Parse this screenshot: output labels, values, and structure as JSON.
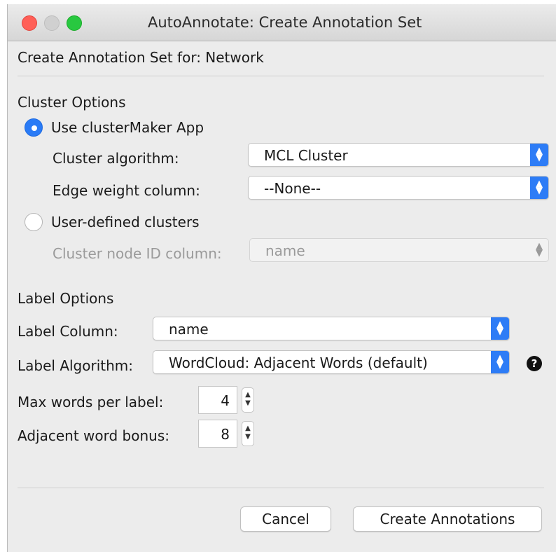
{
  "window": {
    "title": "AutoAnnotate: Create Annotation Set"
  },
  "header": {
    "text": "Create Annotation Set for: Network"
  },
  "cluster_options": {
    "heading": "Cluster Options",
    "use_clustermaker_label": "Use clusterMaker App",
    "use_clustermaker_selected": true,
    "cluster_algorithm_label": "Cluster algorithm:",
    "cluster_algorithm_value": "MCL Cluster",
    "edge_weight_label": "Edge weight column:",
    "edge_weight_value": "--None--",
    "user_defined_label": "User-defined clusters",
    "user_defined_selected": false,
    "node_id_label": "Cluster node ID column:",
    "node_id_value": "name"
  },
  "label_options": {
    "heading": "Label Options",
    "label_column_label": "Label Column:",
    "label_column_value": "name",
    "label_algorithm_label": "Label Algorithm:",
    "label_algorithm_value": "WordCloud: Adjacent Words (default)",
    "max_words_label": "Max words per label:",
    "max_words_value": "4",
    "adjacent_bonus_label": "Adjacent word bonus:",
    "adjacent_bonus_value": "8"
  },
  "buttons": {
    "cancel": "Cancel",
    "create": "Create Annotations"
  },
  "icons": {
    "help": "question-circle-icon",
    "select_arrows": "up-down-chevron-icon",
    "stepper": "stepper-arrows-icon"
  },
  "colors": {
    "accent": "#2d7cf6",
    "close": "#ff5f57",
    "maximize": "#28c840"
  }
}
